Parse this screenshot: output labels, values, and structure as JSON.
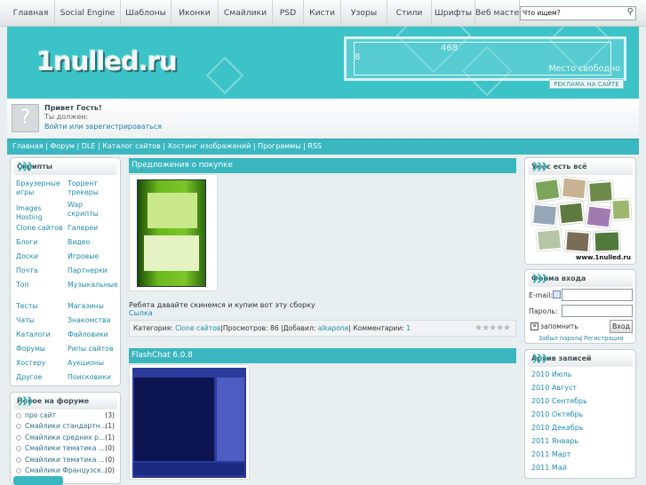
{
  "topnav": [
    "Главная",
    "Social Engine",
    "Шаблоны",
    "Иконки",
    "Смайлики",
    "PSD",
    "Кисти",
    "Узоры",
    "Стили",
    "Шрифты",
    "Веб мастер"
  ],
  "search": {
    "placeholder": "Что ищем?"
  },
  "header": {
    "logo": "1nulled.ru",
    "banner_w": "468",
    "banner_h": "8",
    "banner_text": "Место свободно",
    "advert": "РЕКЛАМА НА САЙТЕ"
  },
  "user": {
    "greeting": "Привет Гость!",
    "must": "Ты должен:",
    "action": "Войти или зарегистрироваться"
  },
  "menubar": "Главная | Форум | DLE | Каталог сайтов | Хостинг изображений | Программы | RSS",
  "scripts": {
    "title": "Скрипты",
    "col1": [
      "Браузерные игры",
      "Images Hosting",
      "Clone сайтов",
      "Блоги",
      "Доски",
      "Почта",
      "Топ",
      "Тесты",
      "Чаты",
      "Каталоги",
      "Форумы",
      "Хостеру",
      "Другое"
    ],
    "col2": [
      "Торрент трекеры",
      "Wap скрипты",
      "Галереи",
      "Видео",
      "Игровые",
      "Партнерки",
      "Музыкальные",
      "Магазины",
      "Знакомства",
      "Файловики",
      "Рипы сайтов",
      "Аукционы",
      "Поисковики"
    ]
  },
  "forum": {
    "title": "Новое на форуме",
    "items": [
      {
        "t": "про сайт",
        "c": "(3)"
      },
      {
        "t": "Смайлики стандартн...",
        "c": "(1)"
      },
      {
        "t": "Смайлики средних р...",
        "c": "(1)"
      },
      {
        "t": "Смайлики тематика ...",
        "c": "(0)"
      },
      {
        "t": "Смайлики тематика ...",
        "c": "(0)"
      },
      {
        "t": "Смайлики Французск...",
        "c": "(0)"
      }
    ]
  },
  "post1": {
    "title": "Предложения о покупке",
    "text": "Ребята давайте скинемся и купим вот эту сборку",
    "link": "Сылка",
    "cat_label": "Категория:",
    "cat": "Clone сайтов",
    "views": "|Просмотров: 86 |Добавил:",
    "author": "alkapone",
    "comments": "| Комментарии:",
    "comm_count": "1"
  },
  "post2": {
    "title": "FlashChat 6.0.8"
  },
  "gallery": {
    "title": "Унас есть всё",
    "watermark": "www.1nulled.ru"
  },
  "login": {
    "title": "Форма входа",
    "email": "E-mail:",
    "pass": "Пароль:",
    "remember": "запомнить",
    "button": "Вход",
    "forgot": "Забыл пароль",
    "sep": "|",
    "register": "Регистрация"
  },
  "archive": {
    "title": "Архив записей",
    "items": [
      "2010 Июль",
      "2010 Август",
      "2010 Сентябрь",
      "2010 Октябрь",
      "2010 Декабрь",
      "2011 Январь",
      "2011 Март",
      "2011 Май"
    ]
  },
  "colors": {
    "accent": "#3ab6bf",
    "header": "#3cc3c8"
  }
}
